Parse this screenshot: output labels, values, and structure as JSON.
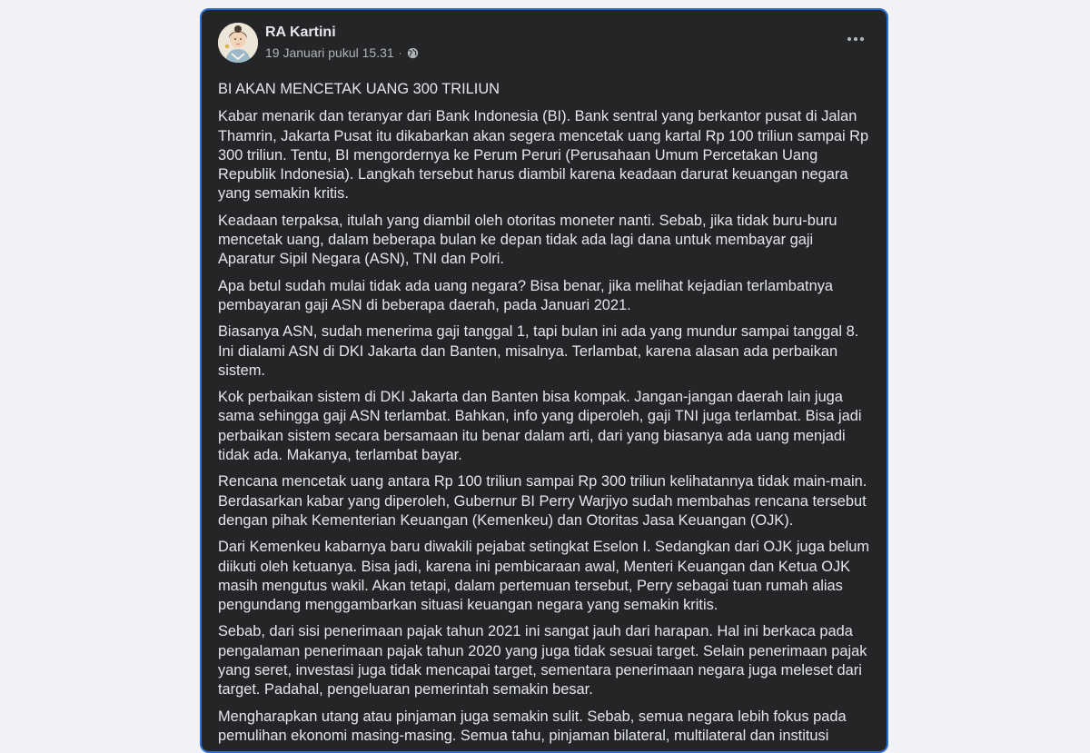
{
  "post": {
    "author": "RA Kartini",
    "timestamp": "19 Januari pukul 15.31",
    "separator": "·",
    "privacy_icon": "globe-icon",
    "more_icon": "more-options-icon",
    "accent_border": "#2d6fd0",
    "background": "#242526",
    "title": "BI AKAN MENCETAK UANG 300 TRILIUN",
    "paragraphs": [
      "Kabar menarik dan teranyar dari Bank Indonesia (BI). Bank sentral yang berkantor pusat di Jalan Thamrin, Jakarta Pusat itu dikabarkan akan segera mencetak uang kartal Rp 100 triliun sampai Rp 300 triliun. Tentu, BI mengordernya ke Perum Peruri (Perusahaan Umum Percetakan Uang Republik Indonesia). Langkah tersebut harus diambil karena keadaan darurat keuangan negara yang semakin kritis.",
      "Keadaan terpaksa, itulah yang diambil oleh otoritas moneter nanti. Sebab, jika tidak buru-buru mencetak uang, dalam beberapa bulan ke depan tidak ada lagi dana untuk membayar gaji Aparatur Sipil Negara (ASN), TNI dan Polri.",
      "Apa betul sudah mulai tidak ada uang negara? Bisa benar, jika melihat kejadian terlambatnya pembayaran gaji ASN di beberapa daerah, pada Januari 2021.",
      "Biasanya ASN, sudah menerima gaji tanggal 1, tapi bulan ini ada yang mundur sampai tanggal 8. Ini dialami ASN di DKI Jakarta dan Banten, misalnya. Terlambat, karena alasan ada perbaikan sistem.",
      "Kok perbaikan sistem di DKI Jakarta dan Banten bisa kompak. Jangan-jangan daerah lain juga sama sehingga gaji ASN terlambat. Bahkan, info yang diperoleh, gaji TNI juga terlambat. Bisa jadi perbaikan sistem secara bersamaan itu benar dalam arti, dari yang biasanya ada uang menjadi tidak ada. Makanya, terlambat bayar.",
      "Rencana mencetak uang antara Rp 100 triliun sampai Rp 300 triliun kelihatannya tidak main-main. Berdasarkan kabar yang diperoleh, Gubernur BI Perry Warjiyo sudah membahas rencana tersebut dengan pihak Kementerian Keuangan (Kemenkeu) dan Otoritas Jasa Keuangan (OJK).",
      "Dari Kemenkeu kabarnya baru diwakili pejabat setingkat Eselon I. Sedangkan dari OJK juga belum diikuti oleh ketuanya. Bisa jadi, karena ini pembicaraan awal, Menteri Keuangan dan Ketua OJK masih mengutus wakil. Akan tetapi, dalam pertemuan tersebut, Perry sebagai tuan rumah alias pengundang menggambarkan situasi keuangan negara yang semakin kritis.",
      "Sebab, dari sisi penerimaan pajak tahun 2021 ini sangat jauh dari harapan. Hal ini berkaca pada pengalaman penerimaan pajak tahun 2020 yang juga tidak sesuai target. Selain penerimaan pajak yang seret, investasi juga tidak mencapai target, sementara penerimaan negara juga meleset dari target. Padahal, pengeluaran pemerintah semakin besar.",
      "Mengharapkan utang atau pinjaman juga semakin sulit. Sebab, semua negara lebih fokus pada pemulihan ekonomi masing-masing. Semua tahu, pinjaman bilateral, multilateral dan institusi"
    ]
  }
}
